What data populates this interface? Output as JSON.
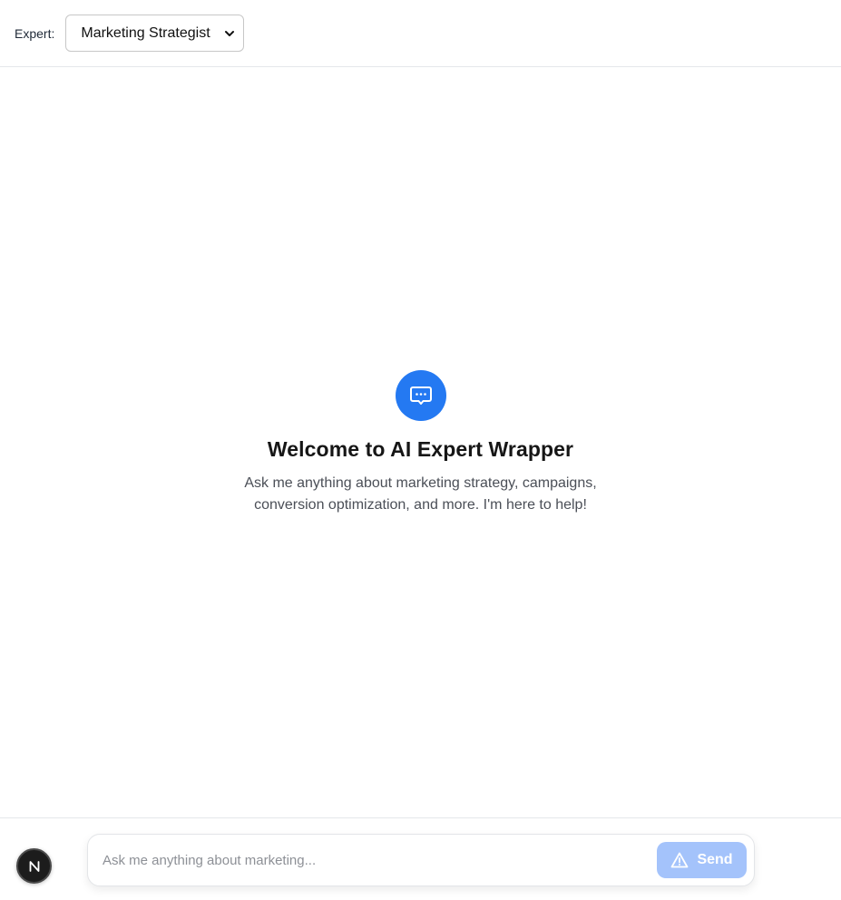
{
  "header": {
    "expert_label": "Expert:",
    "expert_select": {
      "selected": "Marketing Strategist"
    }
  },
  "welcome": {
    "icon": "chat-bubble-icon",
    "title": "Welcome to AI Expert Wrapper",
    "subtitle": "Ask me anything about marketing strategy, campaigns, conversion optimization, and more. I'm here to help!"
  },
  "composer": {
    "placeholder": "Ask me anything about marketing...",
    "value": "",
    "send_label": "Send",
    "send_icon": "warning-triangle-icon"
  },
  "badge": {
    "letter": "N"
  },
  "colors": {
    "accent": "#2479f2",
    "send_disabled": "#a4c3fb",
    "badge_bg": "#1c1c1c"
  }
}
